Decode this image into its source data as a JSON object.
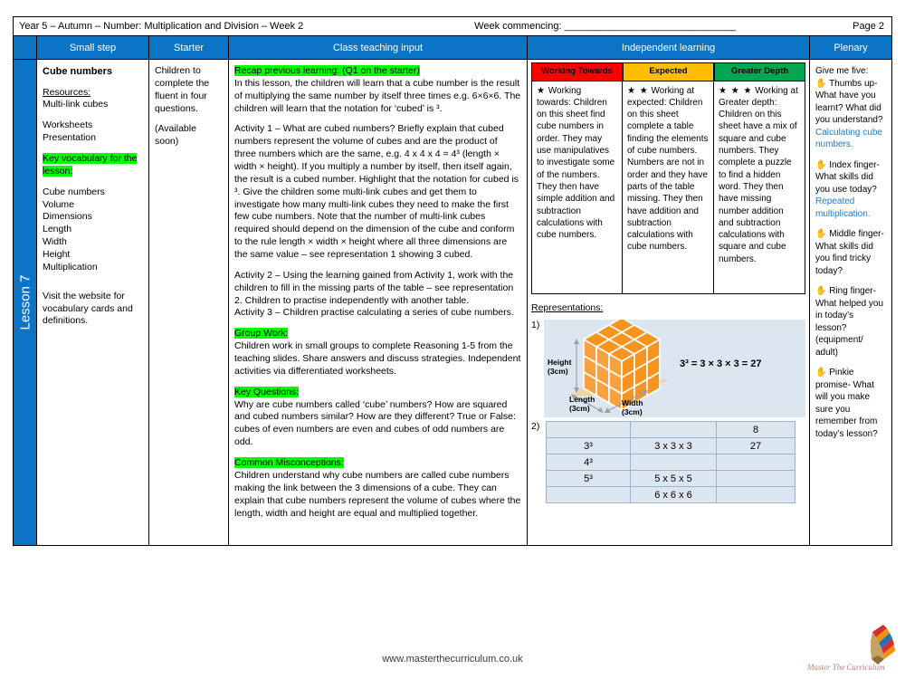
{
  "header": {
    "title": "Year 5 – Autumn – Number: Multiplication and Division – Week 2",
    "week_commencing_label": "Week commencing: _______________________________",
    "page_number": "Page 2"
  },
  "columns": {
    "small_step": "Small step",
    "starter": "Starter",
    "class_teaching_input": "Class teaching input",
    "independent_learning": "Independent learning",
    "plenary": "Plenary"
  },
  "lesson_tab": "Lesson 7",
  "small_step": {
    "title": "Cube numbers",
    "resources_label": "Resources:",
    "resources": [
      "Multi-link cubes"
    ],
    "resources2": [
      "Worksheets",
      "Presentation"
    ],
    "key_vocab_label": "Key vocabulary for the lesson:",
    "vocab": [
      "Cube numbers",
      "Volume",
      "Dimensions",
      "Length",
      "Width",
      "Height",
      "Multiplication"
    ],
    "website_note": "Visit the website for vocabulary cards and definitions."
  },
  "starter": {
    "line1": "Children to complete the fluent in four questions.",
    "line2": "(Available soon)"
  },
  "class_teaching": {
    "recap_label": "Recap previous learning: (Q1 on the starter)",
    "intro": "In this lesson, the children will learn that a cube number is the result of multiplying the same number by itself  three times  e.g. 6×6×6. The children will learn that the notation for ‘cubed’ is ³.",
    "activity1": "Activity 1 – What are cubed numbers? Briefly explain that cubed numbers represent the volume of cubes and are the product of three numbers which are the same, e.g. 4 x 4 x 4 = 4³ (length × width × height). If you multiply a number by itself, then itself again, the result is a cubed number. Highlight that the notation for cubed is ³. Give the children some multi-link cubes and get them to investigate how many multi-link cubes they need to make the first few cube numbers. Note that the number of multi-link cubes required should depend on the dimension of the cube and conform to the rule length × width × height where all three dimensions are the same value – see representation 1 showing 3 cubed.",
    "activity2": "Activity 2 – Using the learning gained from Activity 1, work with the children to fill in the missing parts of the table – see representation 2. Children to practise independently with another table.",
    "activity3": "Activity 3 – Children practise calculating a series of cube numbers.",
    "group_work_label": "Group Work:",
    "group_work": "Children work in small groups to complete Reasoning 1-5 from the teaching slides. Share answers and discuss strategies. Independent activities via differentiated worksheets.",
    "key_questions_label": "Key Questions:",
    "key_questions": "Why are cube numbers called ‘cube’ numbers? How are squared and cubed numbers similar? How are they different? True or False: cubes of even numbers are even and cubes of odd numbers are odd.",
    "misconceptions_label": "Common Misconceptions:",
    "misconceptions": "Children understand why cube numbers are called cube numbers making the link between the 3 dimensions of a cube. They can explain that cube numbers represent the volume of cubes where the length, width and height are equal and multiplied together."
  },
  "independent": {
    "levels": [
      {
        "heading": "Working Towards",
        "color": "#FF0000",
        "stars": "★",
        "lead": "Working towards:",
        "body": "Children on this sheet find cube numbers in order. They may use manipulatives to investigate some of the numbers. They then have simple addition and subtraction calculations with cube numbers."
      },
      {
        "heading": "Expected",
        "color": "#FFBF00",
        "stars": "★ ★",
        "lead": "Working at expected:",
        "body": "Children on this sheet complete a table finding the elements of cube numbers. Numbers are not in order and they have parts of the table missing. They then have addition and subtraction calculations with cube numbers."
      },
      {
        "heading": "Greater Depth",
        "color": "#00A650",
        "stars": "★ ★ ★",
        "lead": "Working at Greater depth:",
        "body": "Children on this sheet have a mix of square and cube numbers. They complete a puzzle to find a hidden word. They then have missing number addition and subtraction calculations with square and cube numbers."
      }
    ],
    "representations_label": "Representations:",
    "rep1_number": "1)",
    "rep2_number": "2)",
    "cube_figure": {
      "height_label": "Height",
      "height_value": "(3cm)",
      "length_label": "Length",
      "length_value": "(3cm)",
      "width_label": "Width",
      "width_value": "(3cm)",
      "equation": "3³ = 3 × 3 × 3 = 27",
      "cube_color": "#F7941E",
      "background": "#DCE6F1"
    },
    "table": [
      [
        "",
        "",
        "8"
      ],
      [
        "3³",
        "3 x 3 x 3",
        "27"
      ],
      [
        "4³",
        "",
        ""
      ],
      [
        "5³",
        "5 x 5 x 5",
        ""
      ],
      [
        "",
        "6 x 6 x 6",
        ""
      ]
    ]
  },
  "plenary": {
    "intro": "Give me five:",
    "items": [
      {
        "icon": "hand-icon",
        "question": "Thumbs up- What have you learnt? What did you understand?",
        "answer": "Calculating cube numbers."
      },
      {
        "icon": "hand-icon",
        "question": "Index finger- What skills did you use today?",
        "answer": "Repeated multiplication."
      },
      {
        "icon": "hand-icon",
        "question": "Middle finger- What skills did you find tricky today?",
        "answer": ""
      },
      {
        "icon": "hand-icon",
        "question": "Ring finger- What helped you in today’s lesson? (equipment/ adult)",
        "answer": ""
      },
      {
        "icon": "hand-icon",
        "question": "Pinkie promise- What will you make sure you remember from today’s lesson?",
        "answer": ""
      }
    ]
  },
  "footer": {
    "url": "www.masterthecurriculum.co.uk"
  }
}
